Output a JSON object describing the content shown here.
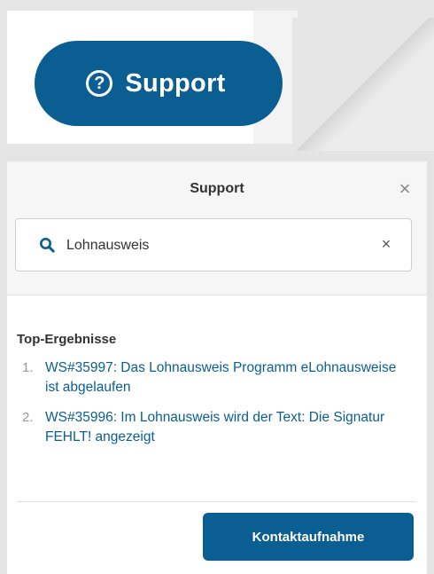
{
  "launcher": {
    "label": "Support",
    "icon": "question-circle-icon"
  },
  "panel": {
    "title": "Support",
    "close_icon": "close-icon",
    "search": {
      "value": "Lohnausweis",
      "clear_icon": "clear-icon"
    },
    "results_heading": "Top-Ergebnisse",
    "results": [
      {
        "num": "1.",
        "text": "WS#35997: Das Lohnausweis Programm eLohnausweise ist abgelaufen"
      },
      {
        "num": "2.",
        "text": "WS#35996: Im Lohnausweis wird der Text: Die Signatur FEHLT! angezeigt"
      }
    ],
    "contact_button": "Kontaktaufnahme"
  },
  "colors": {
    "accent": "#0b5e92",
    "header_bg": "#f6f6f6"
  }
}
